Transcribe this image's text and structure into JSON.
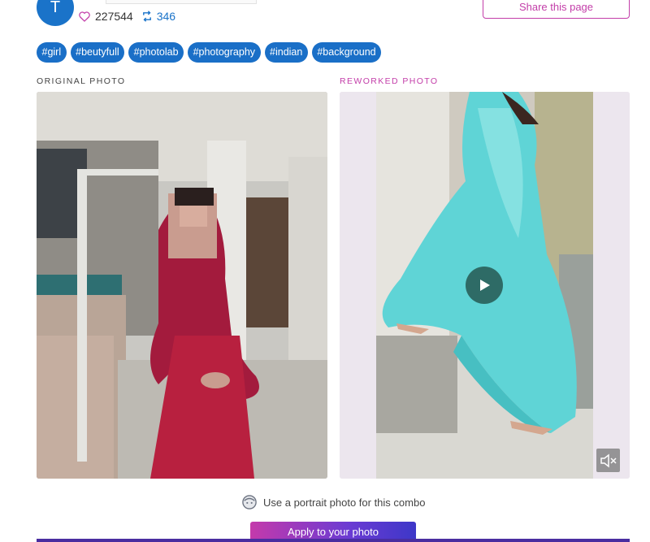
{
  "header": {
    "avatar_letter": "T",
    "likes_count": "227544",
    "remix_count": "346",
    "share_label": "Share this page"
  },
  "tags": [
    "#girl",
    "#beutyfull",
    "#photolab",
    "#photography",
    "#indian",
    "#background"
  ],
  "comparison": {
    "original_label": "ORIGINAL PHOTO",
    "reworked_label": "REWORKED PHOTO"
  },
  "hint": {
    "text": "Use a portrait photo for this combo"
  },
  "cta": {
    "apply_label": "Apply to your photo"
  },
  "colors": {
    "brand_blue": "#1a6fc7",
    "accent_magenta": "#c33ea9",
    "play_teal": "#2e6b66"
  },
  "icons": {
    "like": "heart-icon",
    "remix": "remix-icon",
    "play": "play-icon",
    "mute": "mute-icon",
    "hint": "face-icon"
  }
}
